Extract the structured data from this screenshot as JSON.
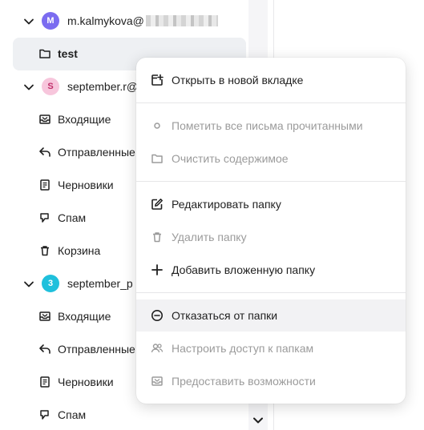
{
  "sidebar": {
    "account1": {
      "email": "m.kalmykova@",
      "badge": "M",
      "badge_color": "#7b6cf0"
    },
    "account1_folders": [
      {
        "label": "test",
        "icon": "folder-icon"
      }
    ],
    "account2": {
      "email": "september.r@",
      "badge": "S",
      "badge_color": "#f7c6dc"
    },
    "account2_folders": [
      {
        "label": "Входящие",
        "icon": "inbox-icon"
      },
      {
        "label": "Отправленные",
        "icon": "sent-icon"
      },
      {
        "label": "Черновики",
        "icon": "drafts-icon"
      },
      {
        "label": "Спам",
        "icon": "spam-icon"
      },
      {
        "label": "Корзина",
        "icon": "trash-icon"
      }
    ],
    "account3": {
      "email": "september_p",
      "badge": "3",
      "badge_color": "#1fc0dc"
    },
    "account3_folders": [
      {
        "label": "Входящие",
        "icon": "inbox-icon"
      },
      {
        "label": "Отправленные",
        "icon": "sent-icon"
      },
      {
        "label": "Черновики",
        "icon": "drafts-icon"
      },
      {
        "label": "Спам",
        "icon": "spam-icon"
      }
    ]
  },
  "context_menu": {
    "open_new_tab": "Открыть в новой вкладке",
    "mark_all_read": "Пометить все письма прочитанными",
    "clear_contents": "Очистить содержимое",
    "edit_folder": "Редактировать папку",
    "delete_folder": "Удалить папку",
    "add_subfolder": "Добавить вложенную папку",
    "unsubscribe_folder": "Отказаться от папки",
    "folder_access": "Настроить доступ к папкам",
    "grant_permissions": "Предоставить возможности"
  },
  "colors": {
    "text": "#1f1f1f",
    "disabled": "#9b9b9b",
    "selected_bg": "#eef0f3",
    "hover_bg": "#f2f2f4"
  }
}
